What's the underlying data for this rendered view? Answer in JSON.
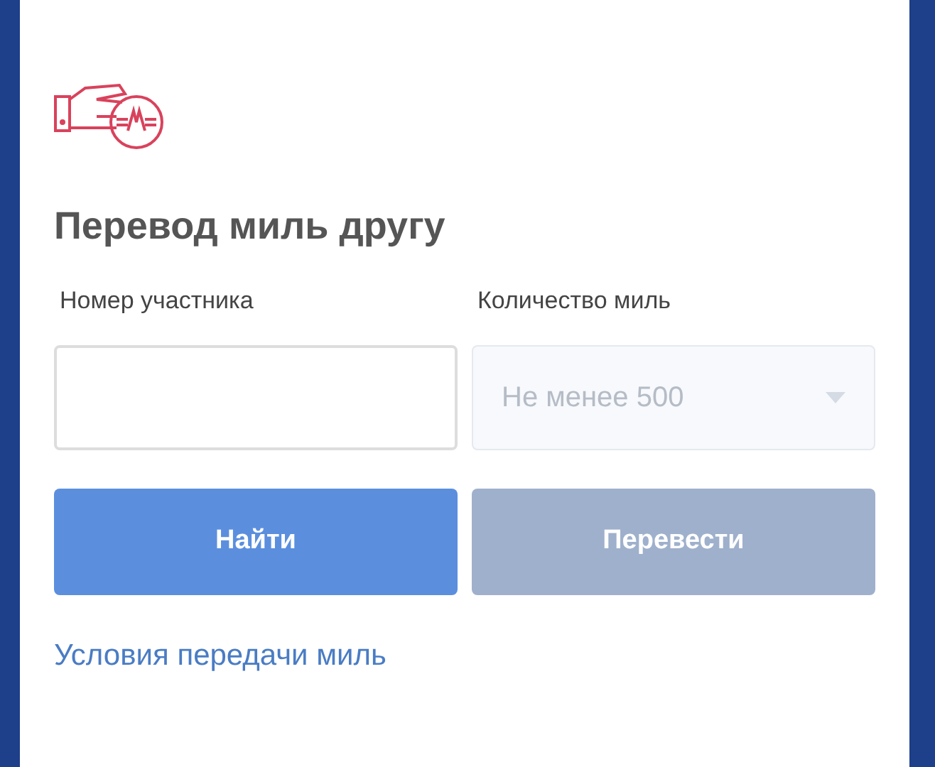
{
  "title": "Перевод миль другу",
  "fields": [
    {
      "kind": "text",
      "label": "Номер участника",
      "disabled": false
    },
    {
      "kind": "select",
      "label": "Количество миль",
      "placeholder": "Не менее 500",
      "disabled": true
    }
  ],
  "buttons": [
    {
      "label": "Найти",
      "disabled": false
    },
    {
      "label": "Перевести",
      "disabled": true
    }
  ],
  "link": "Условия передачи миль"
}
